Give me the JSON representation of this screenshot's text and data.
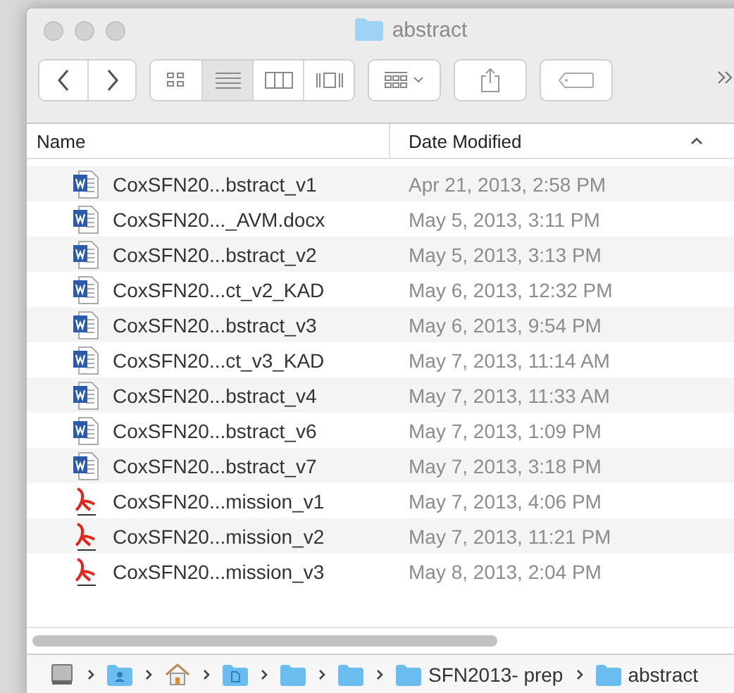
{
  "window": {
    "title": "abstract"
  },
  "toolbar": [
    {
      "kind": "back"
    },
    {
      "kind": "forward"
    },
    {
      "kind": "icon-view",
      "selected": false
    },
    {
      "kind": "list-view",
      "selected": true
    },
    {
      "kind": "column-view",
      "selected": false
    },
    {
      "kind": "cover-view",
      "selected": false
    },
    {
      "kind": "arrange"
    },
    {
      "kind": "share"
    },
    {
      "kind": "tag"
    },
    {
      "kind": "more"
    }
  ],
  "table": {
    "columns": [
      {
        "label": "Name",
        "sorted": false
      },
      {
        "label": "Date Modified",
        "sorted": true
      }
    ],
    "rows": [
      {
        "kind": "word",
        "name": "CoxSFN20...bstract_v1",
        "date": "Apr 21, 2013, 2:58 PM"
      },
      {
        "kind": "word",
        "name": "CoxSFN20..._AVM.docx",
        "date": "May 5, 2013, 3:11 PM"
      },
      {
        "kind": "word",
        "name": "CoxSFN20...bstract_v2",
        "date": "May 5, 2013, 3:13 PM"
      },
      {
        "kind": "word",
        "name": "CoxSFN20...ct_v2_KAD",
        "date": "May 6, 2013, 12:32 PM"
      },
      {
        "kind": "word",
        "name": "CoxSFN20...bstract_v3",
        "date": "May 6, 2013, 9:54 PM"
      },
      {
        "kind": "word",
        "name": "CoxSFN20...ct_v3_KAD",
        "date": "May 7, 2013, 11:14 AM"
      },
      {
        "kind": "word",
        "name": "CoxSFN20...bstract_v4",
        "date": "May 7, 2013, 11:33 AM"
      },
      {
        "kind": "word",
        "name": "CoxSFN20...bstract_v6",
        "date": "May 7, 2013, 1:09 PM"
      },
      {
        "kind": "word",
        "name": "CoxSFN20...bstract_v7",
        "date": "May 7, 2013, 3:18 PM"
      },
      {
        "kind": "pdf",
        "name": "CoxSFN20...mission_v1",
        "date": "May 7, 2013, 4:06 PM"
      },
      {
        "kind": "pdf",
        "name": "CoxSFN20...mission_v2",
        "date": "May 7, 2013, 11:21 PM"
      },
      {
        "kind": "pdf",
        "name": "CoxSFN20...mission_v3",
        "date": "May 8, 2013, 2:04 PM"
      }
    ]
  },
  "path_bar": [
    {
      "kind": "disk"
    },
    {
      "kind": "user"
    },
    {
      "kind": "home"
    },
    {
      "kind": "documents"
    },
    {
      "kind": "folder"
    },
    {
      "kind": "folder"
    },
    {
      "kind": "folder",
      "label": "SFN2013- prep"
    },
    {
      "kind": "folder",
      "label": "abstract"
    }
  ]
}
